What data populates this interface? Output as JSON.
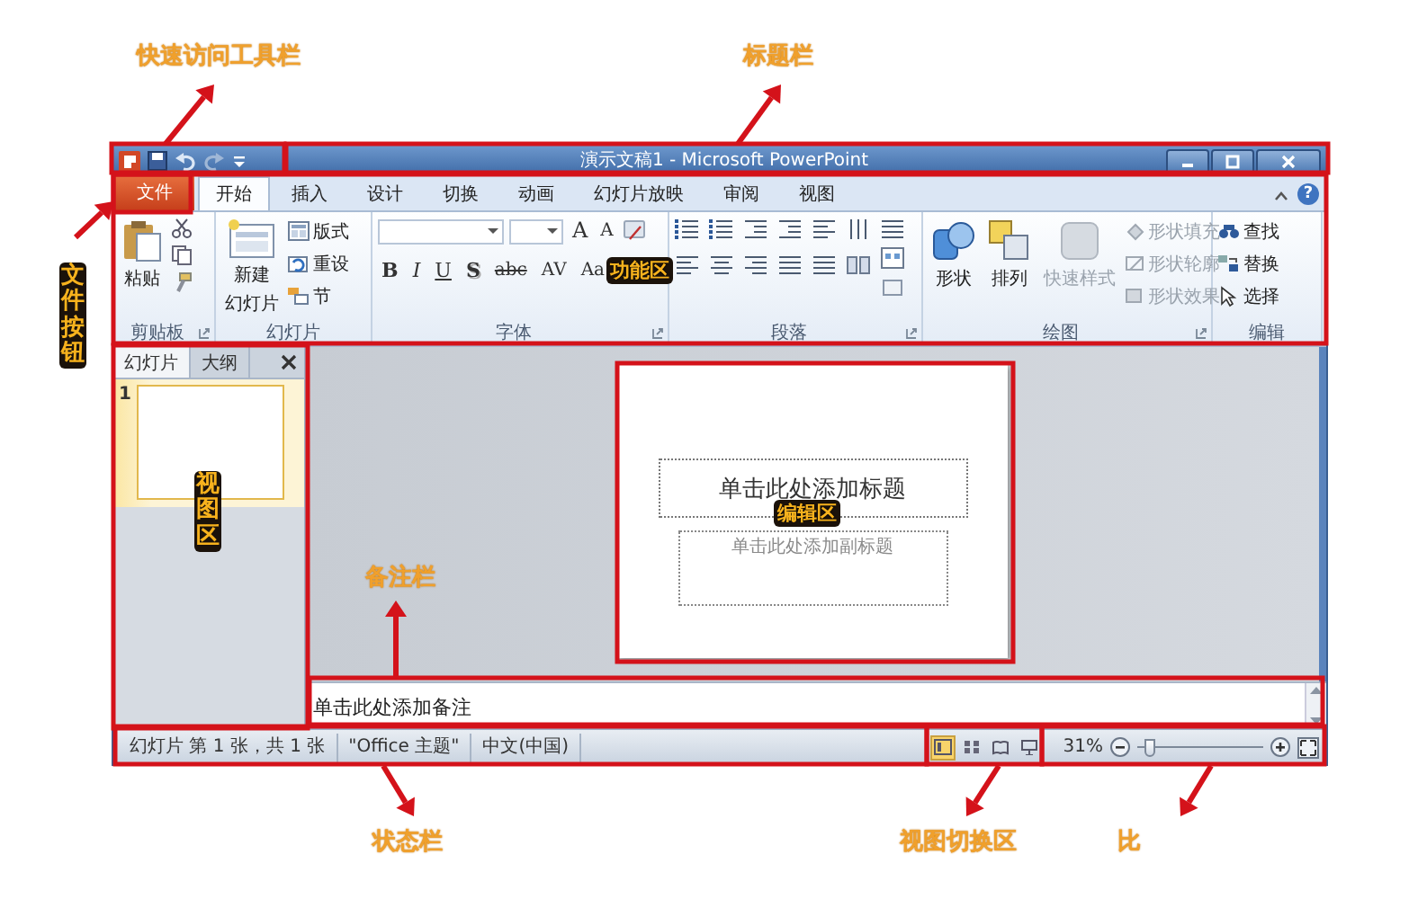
{
  "annotations": [
    {
      "text": "快速访问工具栏",
      "kind": "plain"
    },
    {
      "text": "标题栏",
      "kind": "plain"
    },
    {
      "text": "文件按钮",
      "kind": "vertical"
    },
    {
      "text": "功能区",
      "kind": "badge"
    },
    {
      "text": "视图区",
      "kind": "vertical"
    },
    {
      "text": "编辑区",
      "kind": "badge"
    },
    {
      "text": "备注栏",
      "kind": "plain"
    },
    {
      "text": "状态栏",
      "kind": "plain"
    },
    {
      "text": "视图切换区",
      "kind": "plain"
    },
    {
      "text": "比",
      "kind": "plain"
    }
  ],
  "window": {
    "title": "演示文稿1 - Microsoft PowerPoint"
  },
  "ribbon_tabs": [
    {
      "label": "文件",
      "kind": "file",
      "selected": false
    },
    {
      "label": "开始",
      "kind": "tab",
      "selected": true
    },
    {
      "label": "插入",
      "kind": "tab",
      "selected": false
    },
    {
      "label": "设计",
      "kind": "tab",
      "selected": false
    },
    {
      "label": "切换",
      "kind": "tab",
      "selected": false
    },
    {
      "label": "动画",
      "kind": "tab",
      "selected": false
    },
    {
      "label": "幻灯片放映",
      "kind": "tab",
      "selected": false
    },
    {
      "label": "审阅",
      "kind": "tab",
      "selected": false
    },
    {
      "label": "视图",
      "kind": "tab",
      "selected": false
    }
  ],
  "help_button": "?",
  "ribbon_groups": [
    {
      "label": "剪贴板",
      "kind": "clipboard",
      "items": [
        "粘贴"
      ]
    },
    {
      "label": "幻灯片",
      "kind": "slides",
      "items": [
        "新建",
        "幻灯片",
        "版式",
        "重设",
        "节"
      ]
    },
    {
      "label": "字体",
      "kind": "font",
      "items": [
        "A",
        "A",
        "B",
        "I",
        "U",
        "S",
        "abc",
        "AV",
        "Aa"
      ]
    },
    {
      "label": "段落",
      "kind": "paragraph"
    },
    {
      "label": "绘图",
      "kind": "drawing",
      "items": [
        {
          "label": "形状",
          "disabled": false
        },
        {
          "label": "排列",
          "disabled": false
        },
        {
          "label": "快速样式",
          "disabled": true
        },
        {
          "label": "形状填充",
          "disabled": true
        },
        {
          "label": "形状轮廓",
          "disabled": true
        },
        {
          "label": "形状效果",
          "disabled": true
        }
      ]
    },
    {
      "label": "编辑",
      "kind": "editing",
      "items": [
        "查找",
        "替换",
        "选择"
      ]
    }
  ],
  "panel_tabs": [
    {
      "label": "幻灯片",
      "selected": true
    },
    {
      "label": "大纲",
      "selected": false
    }
  ],
  "thumbnails": [
    {
      "number": "1",
      "selected": true
    }
  ],
  "slide": {
    "title_placeholder": "单击此处添加标题",
    "subtitle_placeholder": "单击此处添加副标题"
  },
  "notes": {
    "placeholder": "单击此处添加备注"
  },
  "status_bar": {
    "items": [
      "幻灯片 第 1 张，共 1 张",
      "\"Office 主题\"",
      "中文(中国)"
    ],
    "views": [
      {
        "selected": true
      },
      {
        "selected": false
      },
      {
        "selected": false
      },
      {
        "selected": false
      }
    ],
    "zoom": "31%",
    "zoom_slider": {
      "level": 0.1
    }
  }
}
